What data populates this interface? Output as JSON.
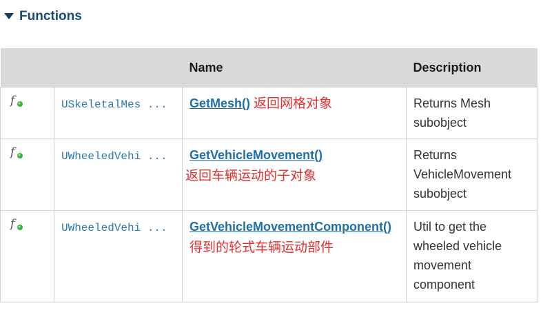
{
  "section": {
    "title": "Functions",
    "toggle_icon": "triangle-down-icon"
  },
  "table": {
    "headers": {
      "icon": "",
      "type": "",
      "name": "Name",
      "description": "Description"
    },
    "rows": [
      {
        "icon": "function-icon",
        "type": "USkeletalMes ...",
        "name": "GetMesh()",
        "annotation": "返回网格对象",
        "description": "Returns Mesh subobject"
      },
      {
        "icon": "function-icon",
        "type": "UWheeledVehi ...",
        "name": "GetVehicleMovement()",
        "annotation": "返回车辆运动的子对象",
        "description": "Returns VehicleMovement subobject"
      },
      {
        "icon": "function-icon",
        "type": "UWheeledVehi ...",
        "name": "GetVehicleMovementComponent()",
        "annotation": "得到的轮式车辆运动部件",
        "description": "Util to get the wheeled vehicle movement component"
      }
    ]
  },
  "colors": {
    "heading": "#1a4a7a",
    "link": "#1f6fa8",
    "type_text": "#2a7ab0",
    "annotation": "#e03030",
    "header_bg": "#d9d9d9",
    "icon_badge": "#3cb043"
  }
}
